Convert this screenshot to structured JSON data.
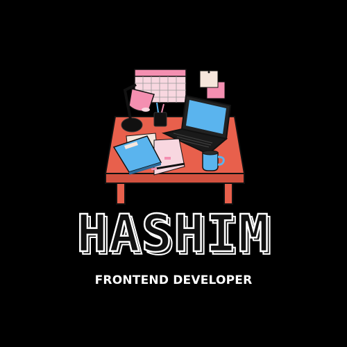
{
  "logo": {
    "name": "HASHIM",
    "tagline": "FRONTEND DEVELOPER"
  },
  "colors": {
    "background": "#000000",
    "desk": "#e8604c",
    "desk_shadow": "#c44a38",
    "outline": "#111111",
    "pink": "#f48fb1",
    "light_pink": "#f8d7e0",
    "blue": "#5ab4ee",
    "paper": "#f6e6dc",
    "text": "#ffffff"
  },
  "icons": [
    "desk-icon",
    "calendar-icon",
    "desk-lamp-icon",
    "sticky-note-icon",
    "pen-cup-icon",
    "laptop-icon",
    "notebook-icon",
    "papers-icon",
    "pen-icon",
    "coffee-mug-icon"
  ]
}
